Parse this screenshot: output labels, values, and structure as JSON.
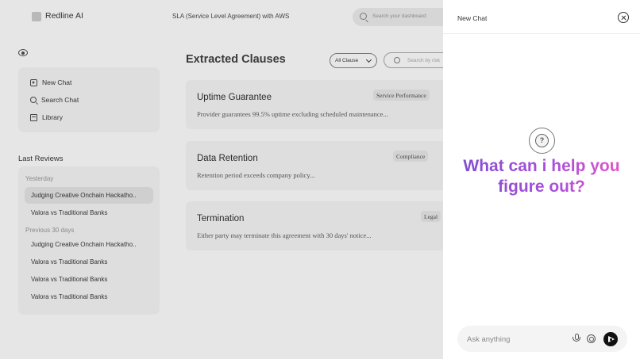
{
  "app": {
    "brand": "Redline AI",
    "document_title": "SLA (Service Level Agreement) with AWS"
  },
  "top_search": {
    "placeholder": "Search your dashboard"
  },
  "sidebar": {
    "nav": [
      {
        "label": "New Chat",
        "icon": "new-chat-icon"
      },
      {
        "label": "Search Chat",
        "icon": "search-icon"
      },
      {
        "label": "Library",
        "icon": "library-icon"
      }
    ],
    "history_title": "Last Reviews",
    "groups": [
      {
        "label": "Yesterday",
        "items": [
          "Judging Creative Onchain Hackatho..",
          "Valora vs Traditional Banks"
        ]
      },
      {
        "label": "Previous 30 days",
        "items": [
          "Judging Creative Onchain Hackatho..",
          "Valora vs Traditional Banks",
          "Valora vs Traditional Banks",
          "Valora vs Traditional Banks"
        ]
      }
    ]
  },
  "main": {
    "title": "Extracted Clauses",
    "filter": {
      "selected": "All Clause"
    },
    "risk_search": {
      "placeholder": "Search by risk"
    },
    "clauses": [
      {
        "title": "Uptime Guarantee",
        "tag": "Service Performance",
        "description": "Provider guarantees 99.5% uptime excluding scheduled maintenance..."
      },
      {
        "title": "Data Retention",
        "tag": "Compliance",
        "description": "Retention period exceeds company policy..."
      },
      {
        "title": "Termination",
        "tag": "Legal",
        "description": "Either party may terminate this agreement with 30 days' notice..."
      }
    ]
  },
  "chat": {
    "header_title": "New Chat",
    "hero_text": "What can i help you figure out?",
    "hero_icon_glyph": "?",
    "input": {
      "placeholder": "Ask anything",
      "value": ""
    }
  },
  "colors": {
    "gradient_start": "#7e4fd0",
    "gradient_end": "#e456c8",
    "send_button": "#111111"
  }
}
